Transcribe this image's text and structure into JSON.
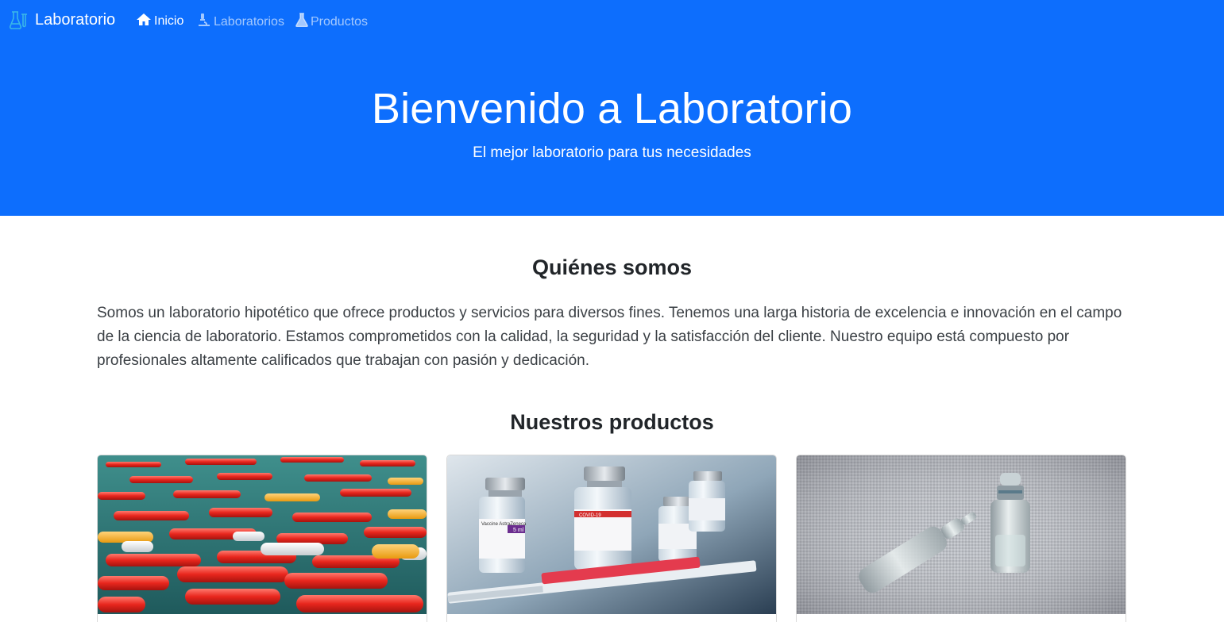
{
  "navbar": {
    "brand": "Laboratorio",
    "brand_icon": "flask-lab-icon",
    "links": [
      {
        "label": "Inicio",
        "icon": "home-icon",
        "active": true
      },
      {
        "label": "Laboratorios",
        "icon": "microscope-icon",
        "active": false
      },
      {
        "label": "Productos",
        "icon": "flask-icon",
        "active": false
      }
    ]
  },
  "hero": {
    "title": "Bienvenido a Laboratorio",
    "subtitle": "El mejor laboratorio para tus necesidades"
  },
  "about": {
    "title": "Quiénes somos",
    "text": "Somos un laboratorio hipotético que ofrece productos y servicios para diversos fines. Tenemos una larga historia de excelencia e innovación en el campo de la ciencia de laboratorio. Estamos comprometidos con la calidad, la seguridad y la satisfacción del cliente. Nuestro equipo está compuesto por profesionales altamente calificados que trabajan con pasión y dedicación."
  },
  "products": {
    "title": "Nuestros productos",
    "cards": [
      {
        "image": "capsules-image"
      },
      {
        "image": "vaccine-vials-image",
        "vial_labels": [
          "Vaccine AstraZeneca",
          "COVID-19",
          "5 ml"
        ]
      },
      {
        "image": "ampoule-image"
      }
    ]
  },
  "colors": {
    "primary": "#0d6efd",
    "text": "#212529",
    "muted_text": "#3a3f44"
  }
}
